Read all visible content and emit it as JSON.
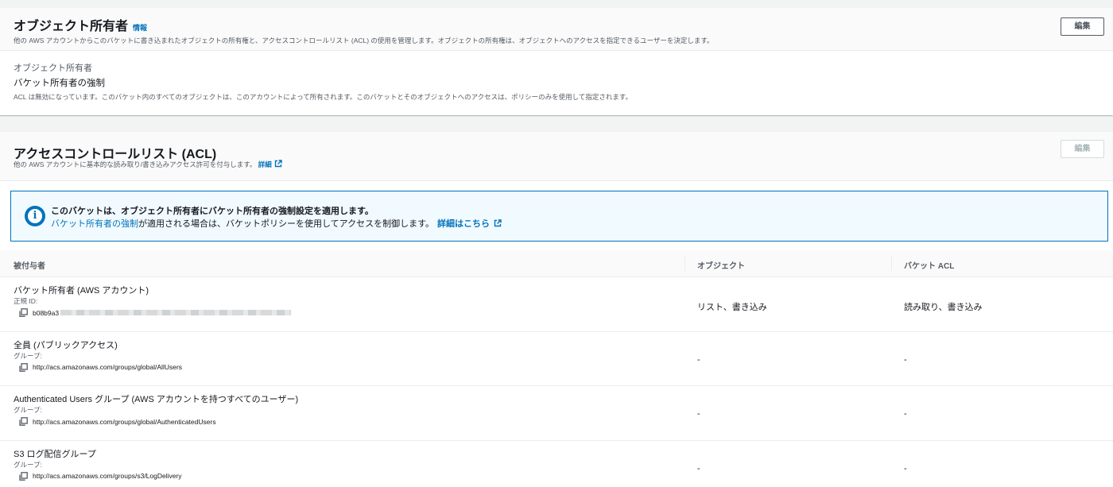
{
  "owner_section": {
    "title": "オブジェクト所有者",
    "info": "情報",
    "description": "他の AWS アカウントからこのバケットに書き込まれたオブジェクトの所有権と、アクセスコントロールリスト (ACL) の使用を管理します。オブジェクトの所有権は、オブジェクトへのアクセスを指定できるユーザーを決定します。",
    "edit_label": "編集",
    "field_label": "オブジェクト所有者",
    "field_value": "バケット所有者の強制",
    "field_desc": "ACL は無効になっています。このバケット内のすべてのオブジェクトは、このアカウントによって所有されます。このバケットとそのオブジェクトへのアクセスは、ポリシーのみを使用して指定されます。"
  },
  "acl_section": {
    "title": "アクセスコントロールリスト (ACL)",
    "description": "他の AWS アカウントに基本的な読み取り/書き込みアクセス許可を付与します。",
    "details_link": "詳細",
    "edit_label": "編集",
    "alert": {
      "title": "このバケットは、オブジェクト所有者にバケット所有者の強制設定を適用します。",
      "link_text": "バケット所有者の強制",
      "text": "が適用される場合は、バケットポリシーを使用してアクセスを制御します。",
      "learn_more": "詳細はこちら"
    },
    "table": {
      "headers": [
        "被付与者",
        "オブジェクト",
        "バケット ACL"
      ],
      "rows": [
        {
          "name": "バケット所有者 (AWS アカウント)",
          "type_label": "正規 ID:",
          "id": "b08b9a3",
          "objects": "リスト、書き込み",
          "bucket_acl": "読み取り、書き込み"
        },
        {
          "name": "全員 (パブリックアクセス)",
          "type_label": "グループ:",
          "id": "http://acs.amazonaws.com/groups/global/AllUsers",
          "objects": "-",
          "bucket_acl": "-"
        },
        {
          "name": "Authenticated Users グループ (AWS アカウントを持つすべてのユーザー)",
          "type_label": "グループ:",
          "id": "http://acs.amazonaws.com/groups/global/AuthenticatedUsers",
          "objects": "-",
          "bucket_acl": "-"
        },
        {
          "name": "S3 ログ配信グループ",
          "type_label": "グループ:",
          "id": "http://acs.amazonaws.com/groups/s3/LogDelivery",
          "objects": "-",
          "bucket_acl": "-"
        }
      ]
    }
  },
  "colors": {
    "link": "#0073bb",
    "alert_bg": "#f1faff",
    "page_bg": "#f2f3f3"
  },
  "icons": {
    "info_alert": "info-circle-icon",
    "external": "external-link-icon",
    "copy": "copy-icon"
  }
}
